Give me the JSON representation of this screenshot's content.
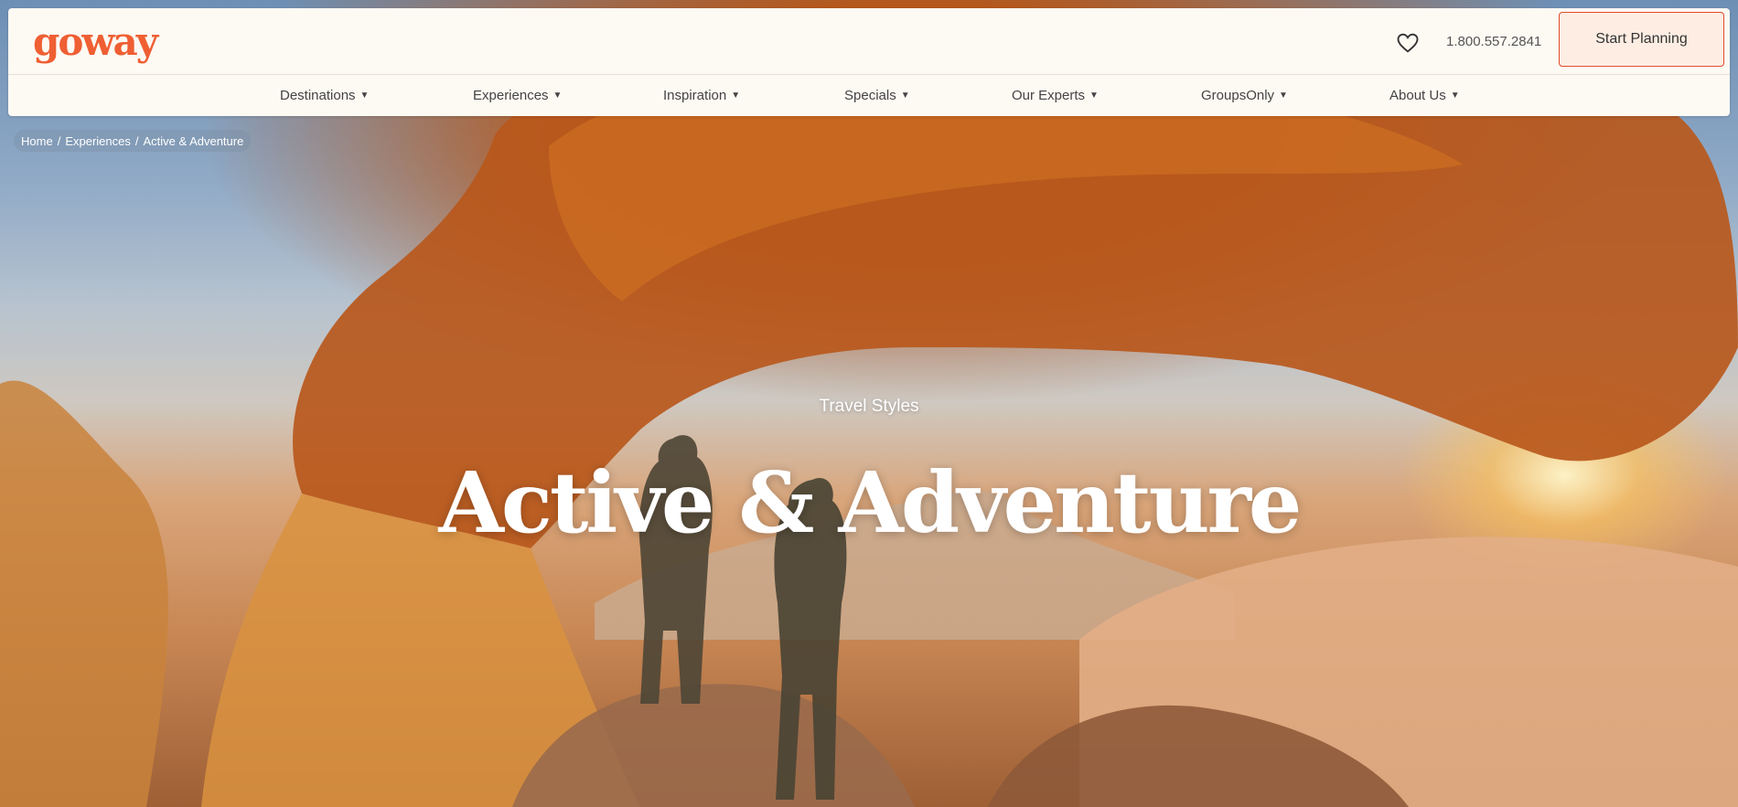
{
  "header": {
    "logo_text": "goway",
    "phone": "1.800.557.2841",
    "cta_label": "Start Planning",
    "favorites_icon": "heart-icon",
    "brand_color": "#ef5f33"
  },
  "nav": {
    "items": [
      {
        "label": "Destinations"
      },
      {
        "label": "Experiences"
      },
      {
        "label": "Inspiration"
      },
      {
        "label": "Specials"
      },
      {
        "label": "Our Experts"
      },
      {
        "label": "GroupsOnly"
      },
      {
        "label": "About Us"
      }
    ],
    "caret_icon": "caret-down-icon"
  },
  "breadcrumb": {
    "home": "Home",
    "experiences": "Experiences",
    "current": "Active & Adventure",
    "separator": "/"
  },
  "hero": {
    "eyebrow": "Travel Styles",
    "title": "Active & Adventure",
    "image_subject": "hero-photo"
  }
}
